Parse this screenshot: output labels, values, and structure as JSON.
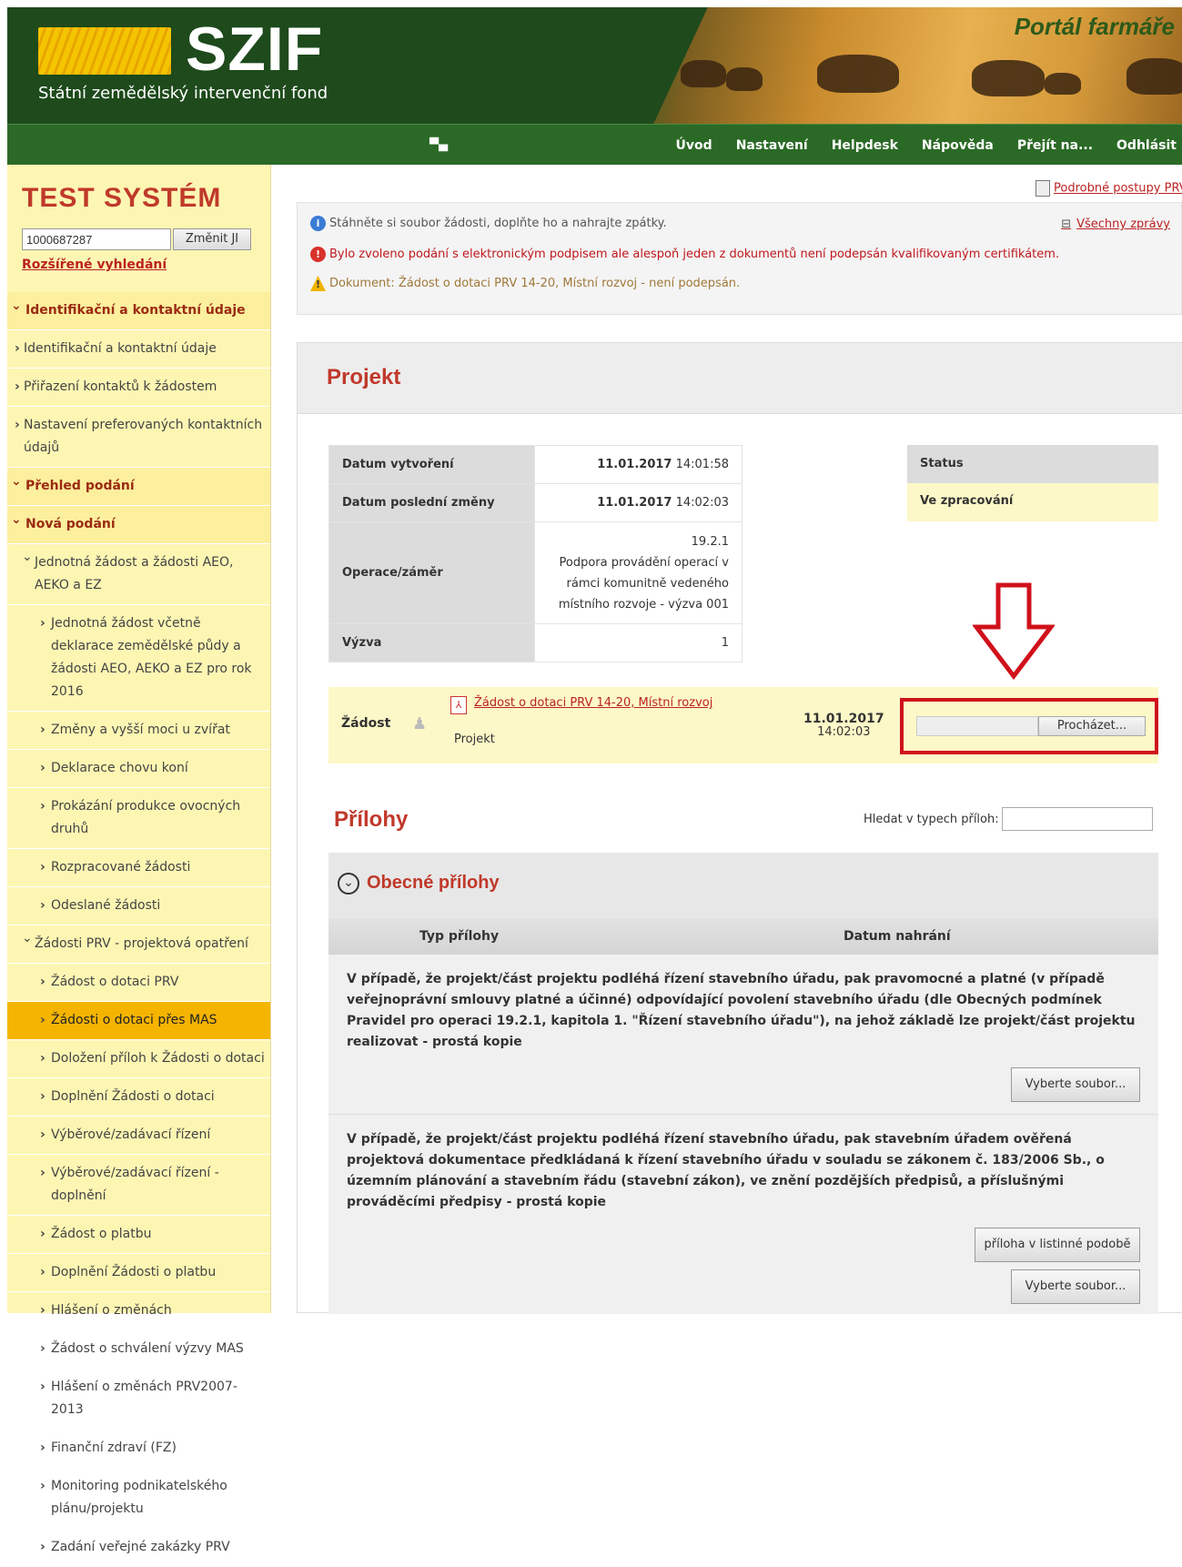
{
  "header": {
    "logo_text": "SZIF",
    "logo_subtitle": "Státní zemědělský intervenční fond",
    "portal_title": "Portál farmáře"
  },
  "nav": {
    "items": [
      "Úvod",
      "Nastavení",
      "Helpdesk",
      "Nápověda",
      "Přejít na...",
      "Odhlásit"
    ]
  },
  "sidebar": {
    "title": "TEST SYSTÉM",
    "id_value": "1000687287",
    "change_button": "Změnit JI",
    "advanced_search": "Rozšířené vyhledání",
    "menu": [
      {
        "label": "Identifikační a kontaktní údaje",
        "level": "sec"
      },
      {
        "label": "Identifikační a kontaktní údaje",
        "level": "l1"
      },
      {
        "label": "Přiřazení kontaktů k žádostem",
        "level": "l1"
      },
      {
        "label": "Nastavení preferovaných kontaktních údajů",
        "level": "l1"
      },
      {
        "label": "Přehled podání",
        "level": "sec"
      },
      {
        "label": "Nová podání",
        "level": "sec"
      },
      {
        "label": "Jednotná žádost a žádosti AEO, AEKO a EZ",
        "level": "l1o"
      },
      {
        "label": "Jednotná žádost včetně deklarace zemědělské půdy a žádosti AEO, AEKO a EZ pro rok 2016",
        "level": "l2"
      },
      {
        "label": "Změny a vyšší moci u zvířat",
        "level": "l2"
      },
      {
        "label": "Deklarace chovu koní",
        "level": "l2"
      },
      {
        "label": "Prokázání produkce ovocných druhů",
        "level": "l2"
      },
      {
        "label": "Rozpracované žádosti",
        "level": "l2"
      },
      {
        "label": "Odeslané žádosti",
        "level": "l2"
      },
      {
        "label": "Žádosti PRV - projektová opatření",
        "level": "l1o"
      },
      {
        "label": "Žádost o dotaci PRV",
        "level": "l2"
      },
      {
        "label": "Žádosti o dotaci přes MAS",
        "level": "l2",
        "active": true
      },
      {
        "label": "Doložení příloh k Žádosti o dotaci",
        "level": "l2"
      },
      {
        "label": "Doplnění Žádosti o dotaci",
        "level": "l2"
      },
      {
        "label": "Výběrové/zadávací řízení",
        "level": "l2"
      },
      {
        "label": "Výběrové/zadávací řízení - doplnění",
        "level": "l2"
      },
      {
        "label": "Žádost o platbu",
        "level": "l2"
      },
      {
        "label": "Doplnění Žádosti o platbu",
        "level": "l2"
      },
      {
        "label": "Hlášení o změnách",
        "level": "l2"
      },
      {
        "label": "Žádost o schválení výzvy MAS",
        "level": "l2"
      },
      {
        "label": "Hlášení o změnách PRV2007-2013",
        "level": "l2"
      },
      {
        "label": "Finanční zdraví (FZ)",
        "level": "l2"
      },
      {
        "label": "Monitoring podnikatelského plánu/projektu",
        "level": "l2"
      },
      {
        "label": "Zadání veřejné zakázky PRV",
        "level": "l2"
      }
    ]
  },
  "main": {
    "help_link": "Podrobné postupy PRV",
    "all_messages": "Všechny zprávy",
    "messages": [
      {
        "type": "info",
        "text": "Stáhněte si soubor žádosti, doplňte ho a nahrajte zpátky."
      },
      {
        "type": "error",
        "text": "Bylo zvoleno podání s elektronickým podpisem ale alespoň jeden z dokumentů není podepsán kvalifikovaným certifikátem."
      },
      {
        "type": "warning",
        "text": "Dokument: Žádost o dotaci PRV 14-20, Místní rozvoj - není podepsán."
      }
    ],
    "project_title": "Projekt",
    "info": {
      "created_label": "Datum vytvoření",
      "created_date": "11.01.2017",
      "created_time": "14:01:58",
      "changed_label": "Datum poslední změny",
      "changed_date": "11.01.2017",
      "changed_time": "14:02:03",
      "operation_label": "Operace/záměr",
      "operation_code": "19.2.1",
      "operation_text": "Podpora provádění operací v rámci komunitně vedeného místního rozvoje - výzva 001",
      "call_label": "Výzva",
      "call_value": "1"
    },
    "status": {
      "label": "Status",
      "value": "Ve zpracování"
    },
    "request": {
      "label": "Žádost",
      "file_name": "Žádost o dotaci PRV 14-20, Místní rozvoj",
      "type": "Projekt",
      "date": "11.01.2017",
      "time": "14:02:03",
      "browse_button": "Procházet..."
    },
    "attachments": {
      "title": "Přílohy",
      "search_label": "Hledat v typech příloh:",
      "group_title": "Obecné přílohy",
      "col_type": "Typ přílohy",
      "col_date": "Datum nahrání",
      "rows": [
        {
          "text": "V případě, že projekt/část projektu podléhá řízení stavebního úřadu, pak pravomocné a platné (v případě veřejnoprávní smlouvy platné a účinné) odpovídající povolení stavebního úřadu (dle Obecných podmínek Pravidel pro operaci 19.2.1, kapitola 1. \"Řízení stavebního úřadu\"), na jehož základě lze projekt/část projektu realizovat - prostá kopie",
          "button": "Vyberte soubor..."
        },
        {
          "text": "V případě, že projekt/část projektu podléhá řízení stavebního úřadu, pak stavebním úřadem ověřená projektová dokumentace předkládaná k řízení stavebního úřadu v souladu se zákonem č. 183/2006 Sb., o územním plánování a stavebním řádu (stavební zákon), ve znění pozdějších předpisů, a příslušnými prováděcími předpisy - prostá kopie",
          "button_paper": "příloha v listinné podobě",
          "button": "Vyberte soubor..."
        }
      ]
    }
  }
}
